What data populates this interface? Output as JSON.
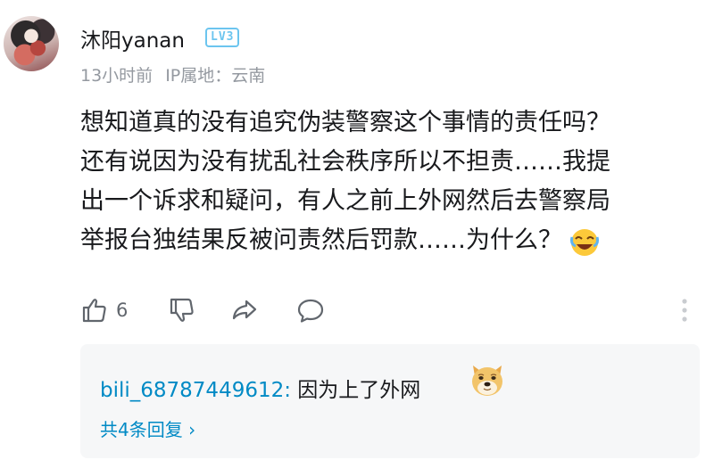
{
  "comment": {
    "username": "沐阳yanan",
    "level": "LV3",
    "time": "13小时前",
    "ip_location": "IP属地：云南",
    "text_lines": [
      "想知道真的没有追究伪装警察这个事情的责任吗？",
      "还有说因为没有扰乱社会秩序所以不担责……我提",
      "出一个诉求和疑问，有人之前上外网然后去警察局",
      "举报台独结果反被问责然后罚款……为什么？"
    ],
    "like_count": "6"
  },
  "reply_preview": {
    "user": "bili_68787449612",
    "separator": ":",
    "text": " 因为上了外网",
    "more_label": "共4条回复 ›"
  },
  "colors": {
    "link": "#008ac5",
    "muted": "#9499a0",
    "badge": "#6cc5ef",
    "reply_bg": "#f6f7f8"
  },
  "icons": [
    "laugh-emoji-icon",
    "thumbs-up-icon",
    "thumbs-down-icon",
    "share-icon",
    "comment-icon",
    "more-vertical-icon",
    "doge-emoji-icon"
  ]
}
